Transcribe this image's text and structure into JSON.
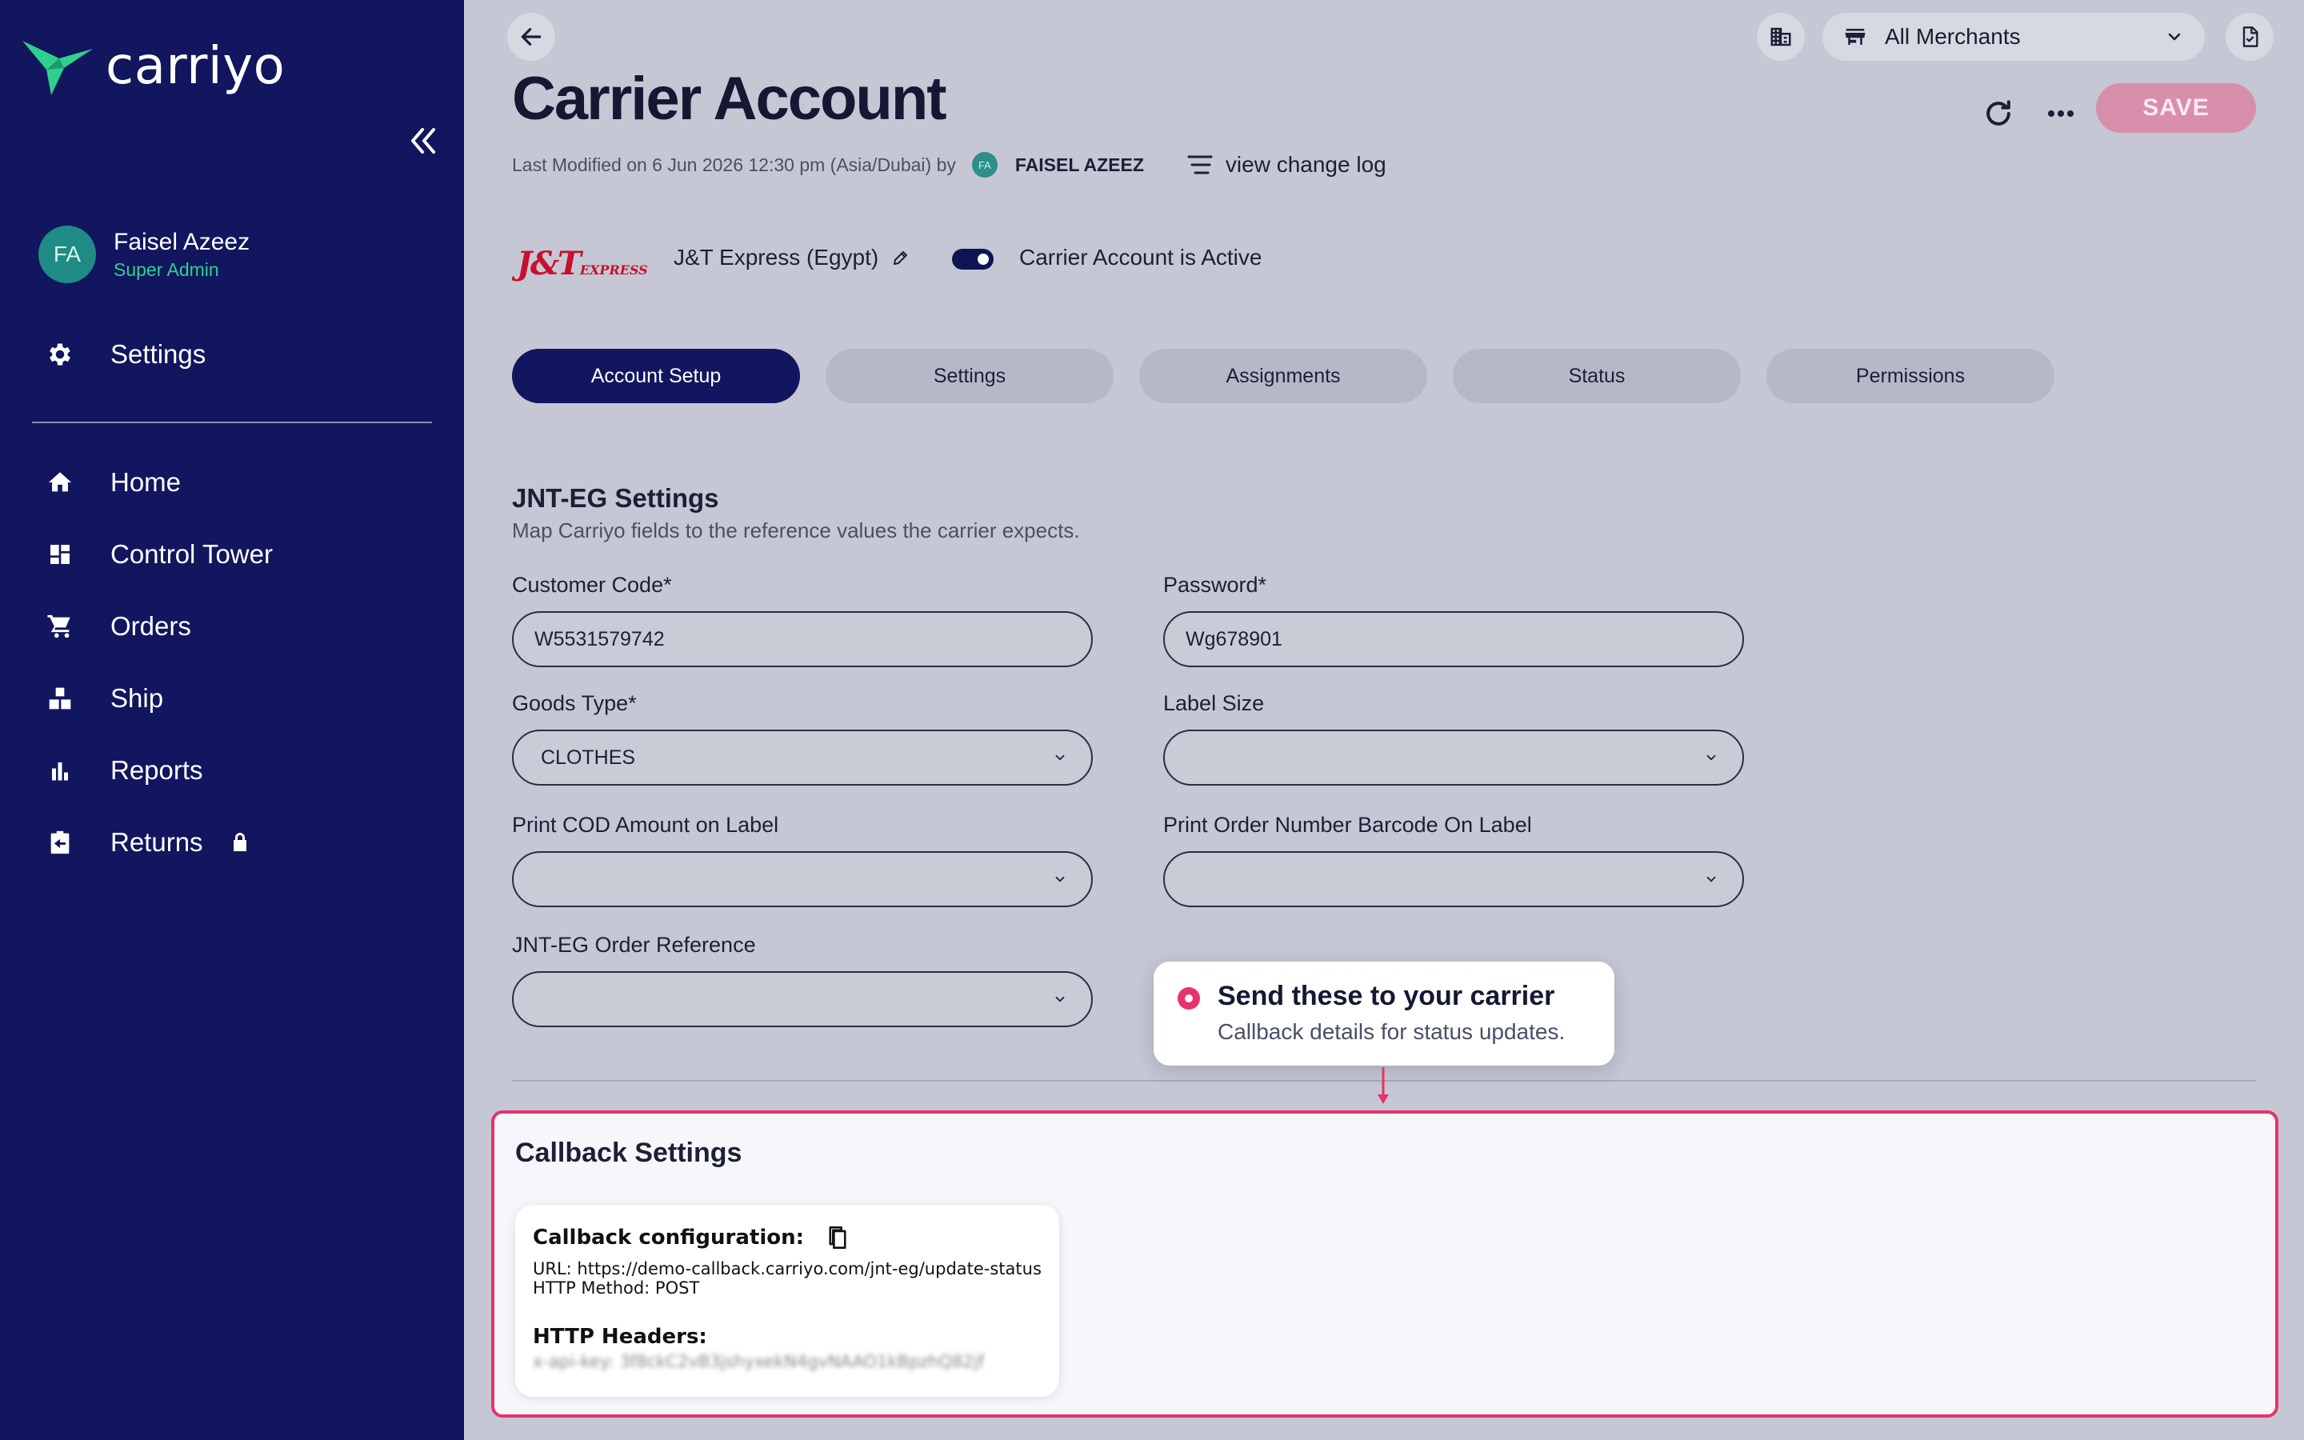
{
  "brand": {
    "name": "carriyo",
    "accent": "#2fd08e"
  },
  "user": {
    "initials": "FA",
    "name": "Faisel Azeez",
    "role": "Super Admin"
  },
  "nav": {
    "settings": "Settings",
    "items": [
      {
        "label": "Home",
        "icon": "home-icon"
      },
      {
        "label": "Control Tower",
        "icon": "dashboard-icon"
      },
      {
        "label": "Orders",
        "icon": "cart-icon"
      },
      {
        "label": "Ship",
        "icon": "ship-icon"
      },
      {
        "label": "Reports",
        "icon": "bar-chart-icon"
      },
      {
        "label": "Returns",
        "icon": "returns-icon"
      }
    ]
  },
  "topbar": {
    "merchant": "All Merchants"
  },
  "page": {
    "title": "Carrier Account",
    "save": "SAVE",
    "modified_text": "Last Modified on 6 Jun 2026 12:30 pm (Asia/Dubai) by",
    "modified_initials": "FA",
    "modified_user": "FAISEL AZEEZ",
    "changelog": "view change log"
  },
  "carrier": {
    "logo_main": "J&T",
    "logo_sub": "EXPRESS",
    "name": "J&T Express (Egypt)",
    "active_label": "Carrier Account is Active",
    "active": true
  },
  "tabs": [
    "Account Setup",
    "Settings",
    "Assignments",
    "Status",
    "Permissions"
  ],
  "form": {
    "title": "JNT-EG Settings",
    "subtitle": "Map Carriyo fields to the reference values the carrier expects.",
    "customer_code_label": "Customer Code*",
    "customer_code": "W5531579742",
    "password_label": "Password*",
    "password": "Wg678901",
    "goods_type_label": "Goods Type*",
    "goods_type": "CLOTHES",
    "label_size_label": "Label Size",
    "label_size": "",
    "print_cod_label": "Print COD Amount on Label",
    "print_cod": "",
    "print_barcode_label": "Print Order Number Barcode On Label",
    "print_barcode": "",
    "order_ref_label": "JNT-EG Order Reference",
    "order_ref": ""
  },
  "tooltip": {
    "title": "Send these to your carrier",
    "subtitle": "Callback details for status updates.",
    "accent": "#e8326b"
  },
  "callback": {
    "title": "Callback Settings",
    "config_label": "Callback configuration:",
    "url_line": "URL: https://demo-callback.carriyo.com/jnt-eg/update-status",
    "method_line": "HTTP Method: POST",
    "headers_label": "HTTP Headers:",
    "headers_value": "x-api-key: 3f8ckC2vB3jshyxekN4gvNAAO1kBpzhQ82jf"
  }
}
